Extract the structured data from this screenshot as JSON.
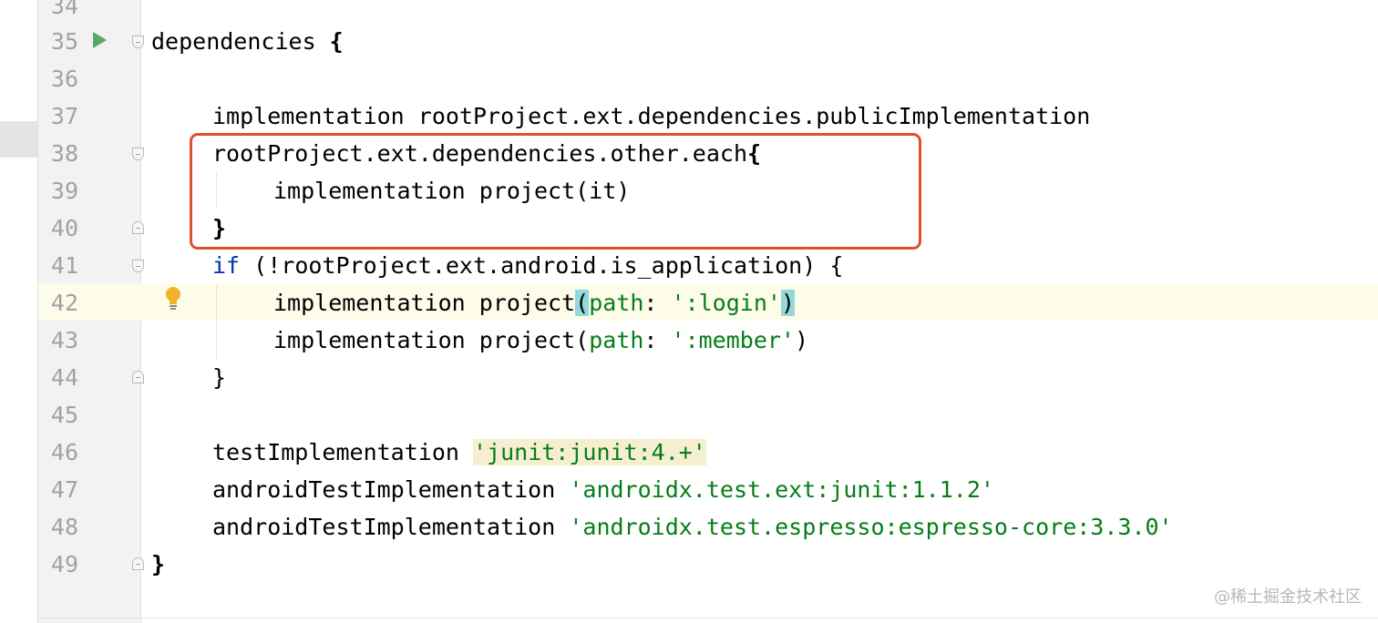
{
  "editor": {
    "line_numbers": [
      "34",
      "35",
      "36",
      "37",
      "38",
      "39",
      "40",
      "41",
      "42",
      "43",
      "44",
      "45",
      "46",
      "47",
      "48",
      "49"
    ],
    "code": {
      "l35_text": "dependencies ",
      "l35_brace": "{",
      "l37": "implementation rootProject.ext.dependencies.publicImplementation",
      "l38_text": "rootProject.ext.dependencies.other.each",
      "l38_brace": "{",
      "l39": "implementation project(it)",
      "l40_brace": "}",
      "l41_kw": "if",
      "l41_rest": " (!rootProject.ext.android.is_application) {",
      "l42_text": "implementation project",
      "l42_open": "(",
      "l42_param": "path",
      "l42_colon": ": ",
      "l42_str": "':login'",
      "l42_close": ")",
      "l43_text": "implementation project(",
      "l43_param": "path",
      "l43_colon": ": ",
      "l43_str": "':member'",
      "l43_close": ")",
      "l44": "}",
      "l46_text": "testImplementation ",
      "l46_str": "'junit:junit:4.+'",
      "l47_text": "androidTestImplementation ",
      "l47_str": "'androidx.test.ext:junit:1.1.2'",
      "l48_text": "androidTestImplementation ",
      "l48_str": "'androidx.test.espresso:espresso-core:3.3.0'",
      "l49_brace": "}"
    },
    "icons": {
      "run": "run-gutter-icon",
      "intention": "lightbulb-icon"
    }
  },
  "watermark": "@稀土掘金技术社区",
  "colors": {
    "keyword": "#0033b3",
    "string": "#067d17",
    "annotation_box": "#e0502c",
    "caret_line": "#fdfce9",
    "brace_match": "#93d9d9"
  }
}
